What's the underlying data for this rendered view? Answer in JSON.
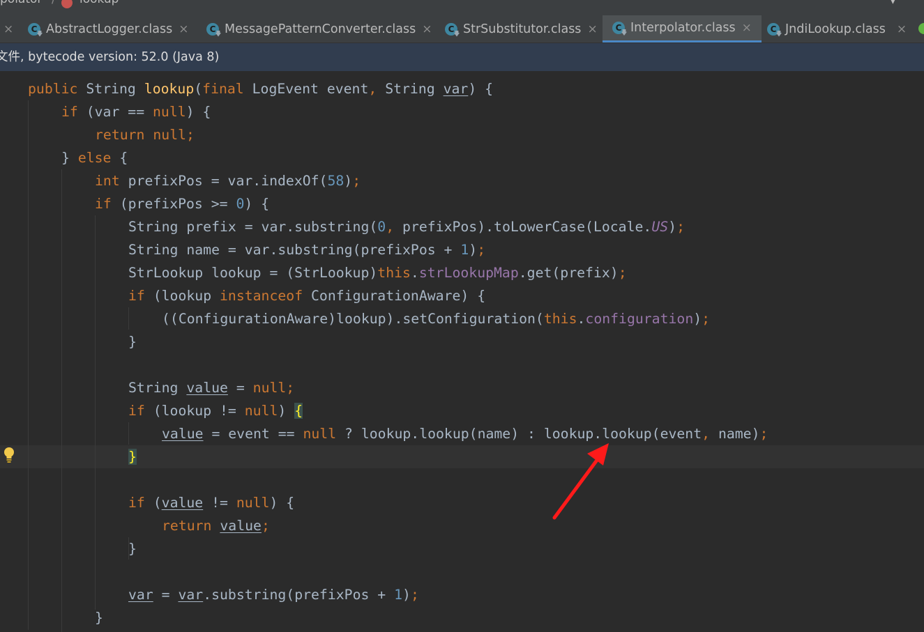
{
  "breadcrumb": {
    "class_part": "polator",
    "separator": "/",
    "method": "lookup"
  },
  "tabs": [
    {
      "label": "AbstractLogger.class",
      "close": "×",
      "active": false
    },
    {
      "label": "MessagePatternConverter.class",
      "close": "×",
      "active": false
    },
    {
      "label": "StrSubstitutor.class",
      "close": "×",
      "active": false
    },
    {
      "label": "Interpolator.class",
      "close": "×",
      "active": true
    },
    {
      "label": "JndiLookup.class",
      "close": "×",
      "active": false
    }
  ],
  "leading_close": "×",
  "banner": {
    "text": "文件, bytecode version: 52.0 (Java 8)"
  },
  "code": {
    "l1": {
      "public": "public",
      "String": "String",
      "name": "lookup",
      "p1": "(",
      "final": "final",
      "sig": "LogEvent event",
      "comma": ",",
      "sig2": " String ",
      "var": "var",
      "end": ") {"
    },
    "l2": {
      "if": "if",
      "mid": " (var == ",
      "null": "null",
      "end": ") {"
    },
    "l3": {
      "return": "return",
      "sp": " ",
      "null": "null",
      "semi": ";"
    },
    "l4": {
      "brace": "} ",
      "else": "else",
      "end": " {"
    },
    "l5": {
      "int": "int",
      "mid": " prefixPos = var.indexOf(",
      "num": "58",
      "end": ")",
      "semi": ";"
    },
    "l6": {
      "if": "if",
      "mid": " (prefixPos >= ",
      "num": "0",
      "end": ") {"
    },
    "l7": {
      "a": "String prefix = var.substring(",
      "n0": "0",
      "comma": ",",
      "b": " prefixPos).toLowerCase(Locale.",
      "us": "US",
      "c": ")",
      "semi": ";"
    },
    "l8": {
      "a": "String name = var.substring(prefixPos + ",
      "n1": "1",
      "c": ")",
      "semi": ";"
    },
    "l9": {
      "a": "StrLookup lookup = (StrLookup)",
      "this": "this",
      "dot": ".",
      "map": "strLookupMap",
      "b": ".get(prefix)",
      "semi": ";"
    },
    "l10": {
      "if": "if",
      "a": " (lookup ",
      "inst": "instanceof",
      "b": " ConfigurationAware) {"
    },
    "l11": {
      "a": "((ConfigurationAware)lookup).setConfiguration(",
      "this": "this",
      "dot": ".",
      "conf": "configuration",
      "c": ")",
      "semi": ";"
    },
    "l12": {
      "a": "}"
    },
    "l13": {
      "a": "String ",
      "value": "value",
      "b": " = ",
      "null": "null",
      "semi": ";"
    },
    "l14": {
      "if": "if",
      "a": " (lookup != ",
      "null": "null",
      "b": ") ",
      "brace": "{"
    },
    "l15": {
      "value": "value",
      "a": " = event == ",
      "null": "null",
      "b": " ? lookup.lookup(name) : lookup.lookup(event",
      "comma": ",",
      "c": " name)",
      "semi": ";"
    },
    "l16": {
      "brace": "}"
    },
    "l17": {
      "if": "if",
      "a": " (",
      "value": "value",
      "b": " != ",
      "null": "null",
      "c": ") {"
    },
    "l18": {
      "return": "return",
      "sp": " ",
      "value": "value",
      "semi": ";"
    },
    "l19": {
      "a": "}"
    },
    "l20": {
      "var1": "var",
      "a": " = ",
      "var2": "var",
      "b": ".substring(prefixPos + ",
      "n1": "1",
      "c": ")",
      "semi": ";"
    },
    "l21": {
      "a": "}"
    }
  },
  "colors": {
    "keyword": "#cc7832",
    "method": "#ffc66d",
    "number": "#6897bb",
    "field": "#9876aa",
    "plain": "#a9b7c6",
    "arrow": "#ff1a1a"
  }
}
